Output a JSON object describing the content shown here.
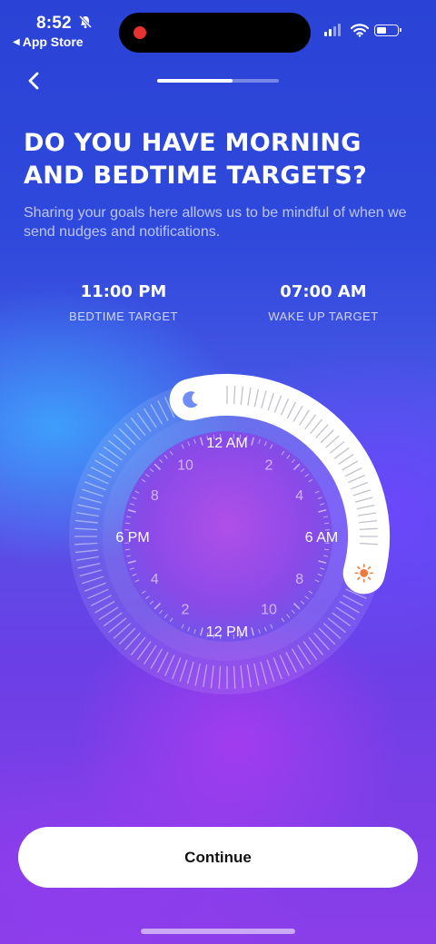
{
  "status_bar": {
    "time": "8:52",
    "back_app_label": "App Store",
    "icons": [
      "bell-slash-icon",
      "signal-icon",
      "wifi-icon",
      "battery-icon"
    ]
  },
  "nav": {
    "back_icon": "chevron-left-icon",
    "progress_fraction": 0.62
  },
  "header": {
    "title": "DO YOU HAVE MORNING AND BEDTIME TARGETS?",
    "subtitle": "Sharing your goals here allows us to be mindful of when we send nudges and notifications."
  },
  "targets": {
    "bedtime": {
      "time": "11:00 PM",
      "label": "BEDTIME TARGET"
    },
    "wake": {
      "time": "07:00 AM",
      "label": "WAKE UP TARGET"
    }
  },
  "dial": {
    "hour_labels": [
      "12 AM",
      "2",
      "4",
      "6 AM",
      "8",
      "10",
      "12 PM",
      "2",
      "4",
      "6 PM",
      "8",
      "10"
    ],
    "bedtime_hour": 23,
    "wake_hour": 7,
    "start_icon": "moon-icon",
    "end_icon": "sun-icon"
  },
  "colors": {
    "accent_moon": "#6f8df5",
    "accent_sun": "#f07a3a",
    "button_bg": "#ffffff"
  },
  "continue_label": "Continue"
}
